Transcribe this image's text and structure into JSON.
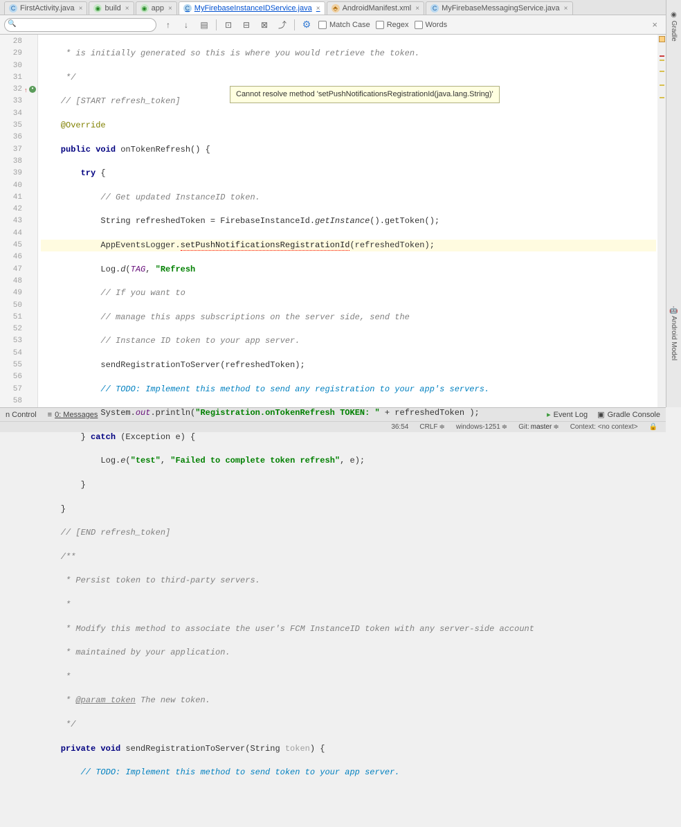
{
  "tabs": [
    {
      "label": "FirstActivity.java",
      "icon": "c"
    },
    {
      "label": "build",
      "icon": "g"
    },
    {
      "label": "app",
      "icon": "g"
    },
    {
      "label": "MyFirebaseInstanceIDService.java",
      "icon": "c",
      "active": true
    },
    {
      "label": "AndroidManifest.xml",
      "icon": "x"
    },
    {
      "label": "MyFirebaseMessagingService.java",
      "icon": "c"
    }
  ],
  "find": {
    "placeholder": "",
    "match_case": "Match Case",
    "regex": "Regex",
    "words": "Words"
  },
  "tooltip": "Cannot resolve method 'setPushNotificationsRegistrationId(java.lang.String)'",
  "lines": {
    "start": 28,
    "end": 58
  },
  "code": {
    "l28": "     * is initially generated so this is where you would retrieve the token.",
    "l29": "     */",
    "l30": "    // [START refresh_token]",
    "l31": "    @Override",
    "l32_a": "    public void ",
    "l32_b": "onTokenRefresh",
    "l32_c": "() {",
    "l33_a": "        try ",
    "l33_b": "{",
    "l34": "            // Get updated InstanceID token.",
    "l35_a": "            String refreshedToken = FirebaseInstanceId.",
    "l35_b": "getInstance",
    "l35_c": "().getToken();",
    "l36_a": "            AppEventsLogger.",
    "l36_b": "setPushNotificationsRegistrationId",
    "l36_c": "(refreshedToken);",
    "l37_a": "            Log.",
    "l37_b": "d",
    "l37_c": "(",
    "l37_d": "TAG",
    "l37_e": ", ",
    "l37_f": "\"Refresh",
    "l38": "            // If you want to",
    "l39": "            // manage this apps subscriptions on the server side, send the",
    "l40": "            // Instance ID token to your app server.",
    "l41": "            sendRegistrationToServer(refreshedToken);",
    "l42": "            // TODO: Implement this method to send any registration to your app's servers.",
    "l43_a": "            System.",
    "l43_b": "out",
    "l43_c": ".println(",
    "l43_d": "\"Registration.onTokenRefresh TOKEN: \"",
    "l43_e": " + refreshedToken );",
    "l44_a": "        } ",
    "l44_b": "catch ",
    "l44_c": "(Exception e) {",
    "l45_a": "            Log.",
    "l45_b": "e",
    "l45_c": "(",
    "l45_d": "\"test\"",
    "l45_e": ", ",
    "l45_f": "\"Failed to complete token refresh\"",
    "l45_g": ", e);",
    "l46": "        }",
    "l47": "    }",
    "l48": "    // [END refresh_token]",
    "l49": "    /**",
    "l50": "     * Persist token to third-party servers.",
    "l51": "     *",
    "l52": "     * Modify this method to associate the user's FCM InstanceID token with any server-side account",
    "l53": "     * maintained by your application.",
    "l54": "     *",
    "l55_a": "     * ",
    "l55_b": "@param token",
    "l55_c": " The new token.",
    "l56": "     */",
    "l57_a": "    private void ",
    "l57_b": "sendRegistrationToServer",
    "l57_c": "(String ",
    "l57_d": "token",
    "l57_e": ") {",
    "l58": "        // TODO: Implement this method to send token to your app server."
  },
  "status1": {
    "version_control": "n Control",
    "messages": "0: Messages",
    "event_log": "Event Log",
    "gradle_console": "Gradle Console"
  },
  "status2": {
    "pos": "36:54",
    "line_sep": "CRLF",
    "encoding": "windows-1251",
    "git_label": "Git:",
    "git_branch": "master",
    "context": "Context: <no context>"
  },
  "right_tabs": {
    "gradle": "Gradle",
    "android_model": "Android Model"
  }
}
